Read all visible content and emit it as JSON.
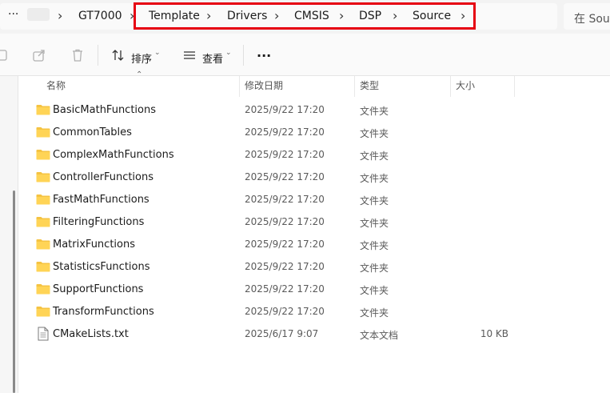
{
  "address_bar": {
    "more": "···",
    "crumbs": [
      "GT7000",
      "Template",
      "Drivers",
      "CMSIS",
      "DSP",
      "Source"
    ],
    "search_prefix": "在 Sour"
  },
  "toolbar": {
    "sort_label": "排序",
    "view_label": "查看",
    "more": "···"
  },
  "columns": {
    "name": "名称",
    "date": "修改日期",
    "type": "类型",
    "size": "大小"
  },
  "files": [
    {
      "name": "BasicMathFunctions",
      "date": "2025/9/22 17:20",
      "type": "文件夹",
      "size": "",
      "icon": "folder-icon"
    },
    {
      "name": "CommonTables",
      "date": "2025/9/22 17:20",
      "type": "文件夹",
      "size": "",
      "icon": "folder-icon"
    },
    {
      "name": "ComplexMathFunctions",
      "date": "2025/9/22 17:20",
      "type": "文件夹",
      "size": "",
      "icon": "folder-icon"
    },
    {
      "name": "ControllerFunctions",
      "date": "2025/9/22 17:20",
      "type": "文件夹",
      "size": "",
      "icon": "folder-icon"
    },
    {
      "name": "FastMathFunctions",
      "date": "2025/9/22 17:20",
      "type": "文件夹",
      "size": "",
      "icon": "folder-icon"
    },
    {
      "name": "FilteringFunctions",
      "date": "2025/9/22 17:20",
      "type": "文件夹",
      "size": "",
      "icon": "folder-icon"
    },
    {
      "name": "MatrixFunctions",
      "date": "2025/9/22 17:20",
      "type": "文件夹",
      "size": "",
      "icon": "folder-icon"
    },
    {
      "name": "StatisticsFunctions",
      "date": "2025/9/22 17:20",
      "type": "文件夹",
      "size": "",
      "icon": "folder-icon"
    },
    {
      "name": "SupportFunctions",
      "date": "2025/9/22 17:20",
      "type": "文件夹",
      "size": "",
      "icon": "folder-icon"
    },
    {
      "name": "TransformFunctions",
      "date": "2025/9/22 17:20",
      "type": "文件夹",
      "size": "",
      "icon": "folder-icon"
    },
    {
      "name": "CMakeLists.txt",
      "date": "2025/6/17 9:07",
      "type": "文本文档",
      "size": "10 KB",
      "icon": "text-file-icon"
    }
  ],
  "colors": {
    "highlight": "#e60012",
    "folder": "#f5c342"
  }
}
